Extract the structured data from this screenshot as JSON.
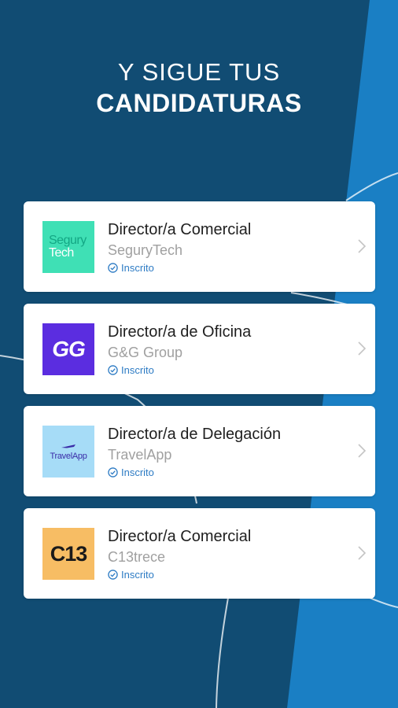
{
  "header": {
    "line1": "Y SIGUE TUS",
    "line2": "CANDIDATURAS"
  },
  "colors": {
    "dark": "#114c73",
    "light": "#1a7fc4",
    "status": "#2d7bc4"
  },
  "applications": [
    {
      "job": "Director/a Comercial",
      "company": "SeguryTech",
      "status": "Inscrito",
      "logo": {
        "line1": "Segury",
        "line2": "Tech",
        "bg": "#3fe0b5"
      }
    },
    {
      "job": "Director/a de Oficina",
      "company": "G&G Group",
      "status": "Inscrito",
      "logo": {
        "text": "GG",
        "bg": "#5b2de0"
      }
    },
    {
      "job": "Director/a de Delegación",
      "company": "TravelApp",
      "status": "Inscrito",
      "logo": {
        "text": "TravelApp",
        "bg": "#a6dcf7"
      }
    },
    {
      "job": "Director/a Comercial",
      "company": "C13trece",
      "status": "Inscrito",
      "logo": {
        "text": "C13",
        "bg": "#f7bd64"
      }
    }
  ]
}
